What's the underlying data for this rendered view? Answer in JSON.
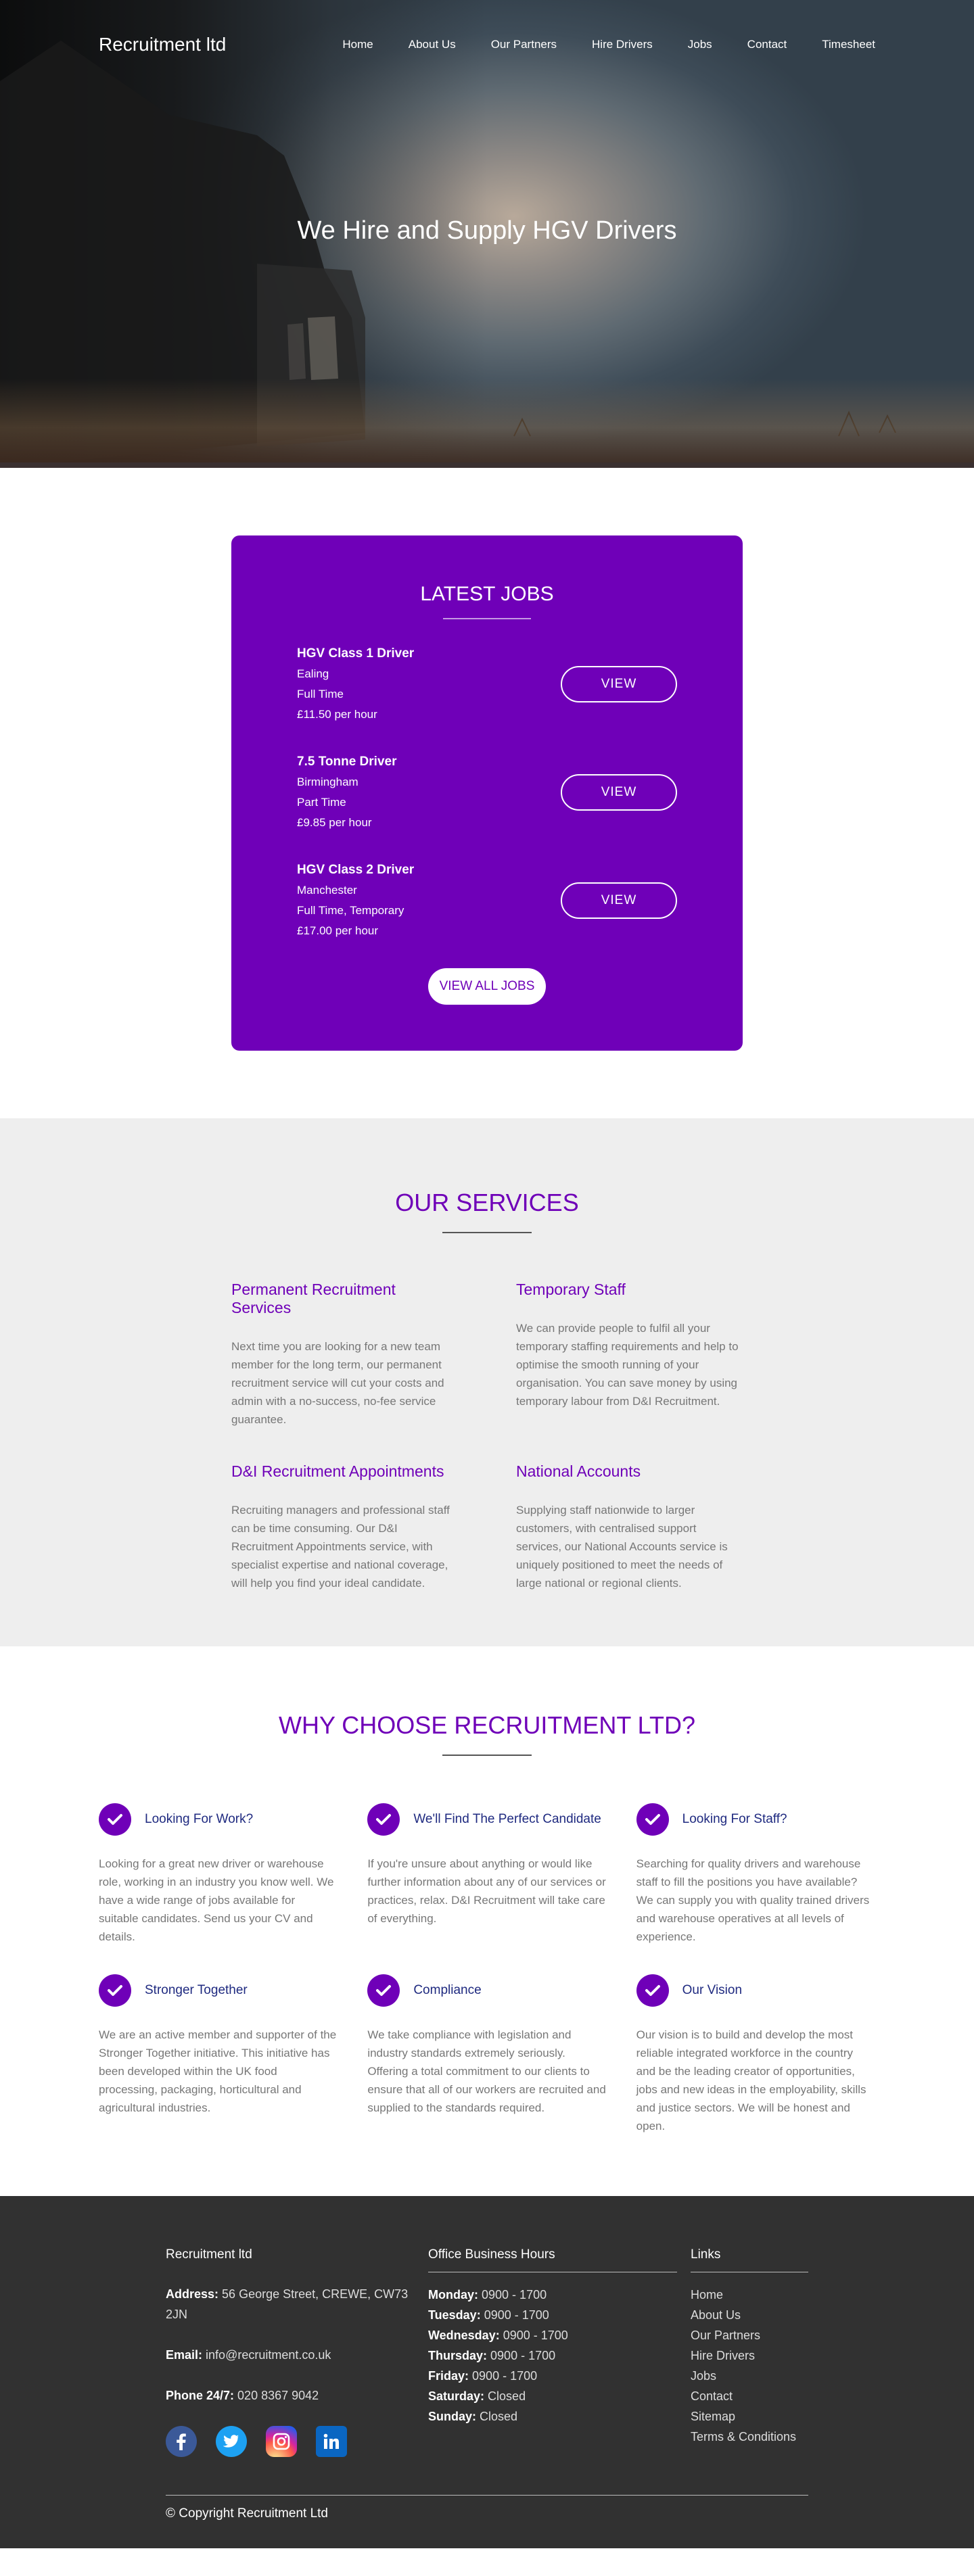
{
  "header": {
    "brand": "Recruitment ltd",
    "nav": [
      "Home",
      "About Us",
      "Our Partners",
      "Hire Drivers",
      "Jobs",
      "Contact",
      "Timesheet"
    ],
    "hero_title": "We Hire and Supply HGV Drivers"
  },
  "jobs": {
    "title": "LATEST JOBS",
    "items": [
      {
        "title": "HGV Class 1 Driver",
        "location": "Ealing",
        "type": "Full Time",
        "pay": "£11.50 per hour",
        "button": "VIEW"
      },
      {
        "title": "7.5 Tonne Driver",
        "location": "Birmingham",
        "type": "Part Time",
        "pay": "£9.85 per hour",
        "button": "VIEW"
      },
      {
        "title": "HGV Class 2 Driver",
        "location": "Manchester",
        "type": "Full Time, Temporary",
        "pay": "£17.00 per hour",
        "button": "VIEW"
      }
    ],
    "view_all": "VIEW ALL JOBS"
  },
  "services": {
    "title": "OUR SERVICES",
    "items": [
      {
        "title": "Permanent Recruitment Services",
        "text": "Next time you are looking for a new team member for the long term, our permanent recruitment service will cut your costs and admin with a no-success, no-fee service guarantee."
      },
      {
        "title": "Temporary Staff",
        "text": "We can provide people to fulfil all your temporary staffing requirements and help to optimise the smooth running of your organisation. You can save money by using temporary labour from D&I Recruitment."
      },
      {
        "title": "D&I Recruitment Appointments",
        "text": "Recruiting managers and professional staff can be time consuming. Our D&I Recruitment  Appointments service, with specialist expertise and national coverage, will help you find your ideal candidate."
      },
      {
        "title": "National Accounts",
        "text": "Supplying staff nationwide to larger customers, with centralised support services, our National Accounts service is uniquely positioned to meet the needs of large national or regional clients."
      }
    ]
  },
  "why": {
    "title": "WHY CHOOSE RECRUITMENT LTD?",
    "items": [
      {
        "title": "Looking For Work?",
        "text": "Looking for a great new driver or warehouse role, working in an industry you know well. We have a wide range of jobs available for suitable candidates. Send us your CV and details."
      },
      {
        "title": "We'll Find The Perfect Candidate",
        "text": "If you're unsure about anything or would like further information about any of our services or practices, relax. D&I Recruitment will take care of everything."
      },
      {
        "title": "Looking For Staff?",
        "text": "Searching for quality drivers and warehouse staff to fill the positions you have available? We can supply you with quality trained drivers and warehouse operatives at all levels of experience."
      },
      {
        "title": "Stronger Together",
        "text": "We are an active member and supporter of the Stronger Together initiative. This initiative has been developed within the UK food processing, packaging, horticultural and agricultural industries."
      },
      {
        "title": "Compliance",
        "text": "We take compliance with legislation and industry standards extremely seriously. Offering a total commitment to our clients to ensure that all of our workers are recruited and supplied to the standards required."
      },
      {
        "title": "Our Vision",
        "text": "Our vision is to build and develop the most reliable integrated workforce in the country and be the leading creator of opportunities, jobs and new ideas in the employability, skills and justice sectors. We will be honest and open."
      }
    ]
  },
  "footer": {
    "company": "Recruitment ltd",
    "address_label": "Address:",
    "address": "56 George Street, CREWE, CW73 2JN",
    "email_label": "Email:",
    "email": "info@recruitment.co.uk",
    "phone_label": "Phone 24/7:",
    "phone": "020 8367 9042",
    "hours_title": "Office Business Hours",
    "hours": [
      {
        "day": "Monday:",
        "time": "0900 - 1700"
      },
      {
        "day": "Tuesday:",
        "time": "0900 - 1700"
      },
      {
        "day": "Wednesday:",
        "time": "0900 - 1700"
      },
      {
        "day": "Thursday:",
        "time": "0900 - 1700"
      },
      {
        "day": "Friday:",
        "time": "0900 - 1700"
      },
      {
        "day": "Saturday:",
        "time": "Closed"
      },
      {
        "day": "Sunday:",
        "time": "Closed"
      }
    ],
    "links_title": "Links",
    "links": [
      "Home",
      "About Us",
      "Our Partners",
      "Hire Drivers",
      "Jobs",
      "Contact",
      "Sitemap",
      "Terms & Conditions"
    ],
    "social_icons": [
      "facebook-icon",
      "twitter-icon",
      "instagram-icon",
      "linkedin-icon"
    ],
    "copyright": "© Copyright Recruitment Ltd"
  },
  "colors": {
    "accent": "#6f00b8",
    "footer_bg": "#313131",
    "services_bg": "#eeeeee",
    "why_heading": "#1f2a80"
  }
}
